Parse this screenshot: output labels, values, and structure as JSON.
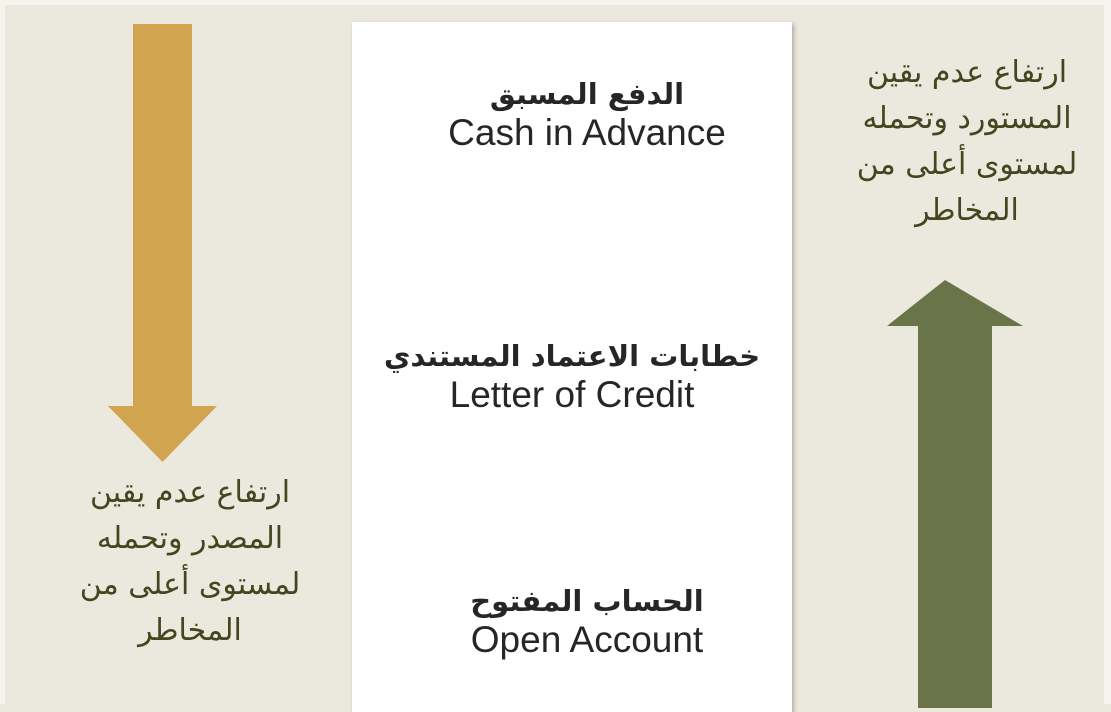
{
  "background_color": "#ebe8dd",
  "panel_color": "#ffffff",
  "colors": {
    "left_arrow": "#d1a44f",
    "right_arrow": "#697548",
    "side_text": "#45451f",
    "item_text": "#262626"
  },
  "left": {
    "arrow_direction": "down",
    "lines": [
      "ارتفاع عدم يقين",
      "المصدر وتحمله",
      "لمستوى أعلى من",
      "المخاطر"
    ]
  },
  "right": {
    "arrow_direction": "up",
    "lines": [
      "ارتفاع عدم يقين",
      "المستورد وتحمله",
      "لمستوى أعلى من",
      "المخاطر"
    ]
  },
  "methods": [
    {
      "arabic": "الدفع المسبق",
      "english": "Cash in Advance"
    },
    {
      "arabic": "خطابات الاعتماد المستندي",
      "english": "Letter of Credit"
    },
    {
      "arabic": "الحساب المفتوح",
      "english": "Open Account"
    }
  ]
}
